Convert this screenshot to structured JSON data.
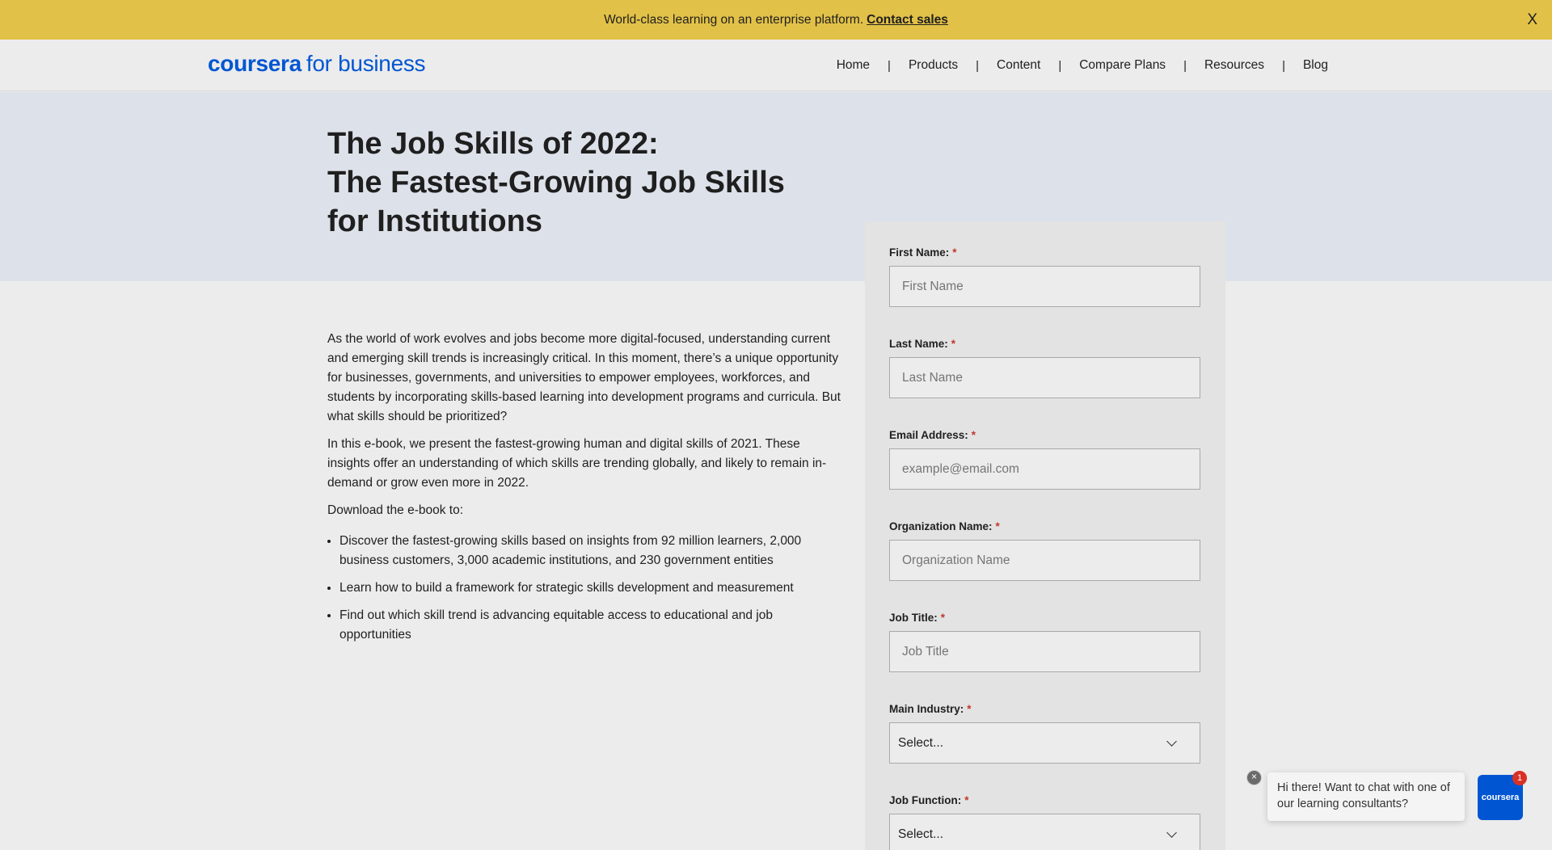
{
  "banner": {
    "text": "World-class learning on an enterprise platform.",
    "link": "Contact sales",
    "close": "X"
  },
  "header": {
    "logo_brand": "coursera",
    "logo_suffix": "for business",
    "nav": [
      "Home",
      "Products",
      "Content",
      "Compare Plans",
      "Resources",
      "Blog"
    ],
    "separator": "|"
  },
  "hero": {
    "title_line1": "The Job Skills of 2022:",
    "title_line2": "The Fastest-Growing Job Skills for Institutions"
  },
  "content": {
    "paragraphs": [
      "As the world of work evolves and jobs become more digital-focused, understanding current and emerging skill trends is increasingly critical. In this moment, there’s a unique opportunity for businesses, governments, and universities to empower employees, workforces, and students by incorporating skills-based learning into development programs and curricula. But what skills should be prioritized?",
      "In this e-book, we present the fastest-growing human and digital skills of 2021. These insights offer an understanding of which skills are trending globally, and likely to remain in-demand or grow even more in 2022.",
      "Download the e-book to:"
    ],
    "bullets": [
      "Discover the fastest-growing skills based on insights from 92 million learners, 2,000 business customers, 3,000 academic institutions, and 230 government entities",
      "Learn how to build a framework for strategic skills development and measurement",
      "Find out which skill trend is advancing equitable access to educational and job opportunities"
    ]
  },
  "form": {
    "required_mark": "*",
    "first_name": {
      "label": "First Name:",
      "placeholder": "First Name"
    },
    "last_name": {
      "label": "Last Name:",
      "placeholder": "Last Name"
    },
    "email": {
      "label": "Email Address:",
      "placeholder": "example@email.com"
    },
    "organization": {
      "label": "Organization Name:",
      "placeholder": "Organization Name"
    },
    "job_title": {
      "label": "Job Title:",
      "placeholder": "Job Title"
    },
    "main_industry": {
      "label": "Main Industry:",
      "value": "Select..."
    },
    "job_function": {
      "label": "Job Function:",
      "value": "Select..."
    }
  },
  "chat": {
    "message": "Hi there! Want to chat with one of our learning consultants?",
    "launcher_label": "coursera",
    "badge_count": "1",
    "close": "×"
  },
  "colors": {
    "banner_bg": "#e2c148",
    "brand_blue": "#0056d2",
    "hero_bg": "#dde2ea",
    "required_red": "#c0362c"
  }
}
